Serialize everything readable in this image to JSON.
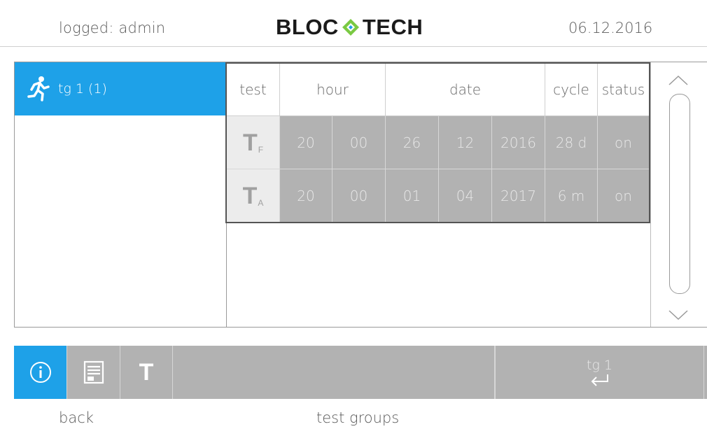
{
  "header": {
    "user": "logged: admin",
    "logo_left": "BLOC",
    "logo_right": "TECH",
    "date": "06.12.2016"
  },
  "colors": {
    "accent": "#1ea1e8",
    "data_cell": "#b2b2b2",
    "toolbar": "#b2b2b2"
  },
  "groups": [
    {
      "label": "tg 1 (1)",
      "icon": "running-man-icon",
      "selected": true
    }
  ],
  "table": {
    "headers": {
      "test": "test",
      "hour": "hour",
      "date": "date",
      "cycle": "cycle",
      "status": "status"
    },
    "rows": [
      {
        "type_letter": "T",
        "type_sub": "F",
        "hour": "20",
        "minute": "00",
        "day": "26",
        "month": "12",
        "year": "2016",
        "cycle": "28 d",
        "status": "on"
      },
      {
        "type_letter": "T",
        "type_sub": "A",
        "hour": "20",
        "minute": "00",
        "day": "01",
        "month": "04",
        "year": "2017",
        "cycle": "6 m",
        "status": "on"
      }
    ]
  },
  "toolbar": {
    "info_icon": "info-icon",
    "list_icon": "list-icon",
    "test_label": "T",
    "group_label": "tg 1",
    "enter_icon": "enter-arrow-icon"
  },
  "footer": {
    "back": "back",
    "title": "test groups"
  }
}
